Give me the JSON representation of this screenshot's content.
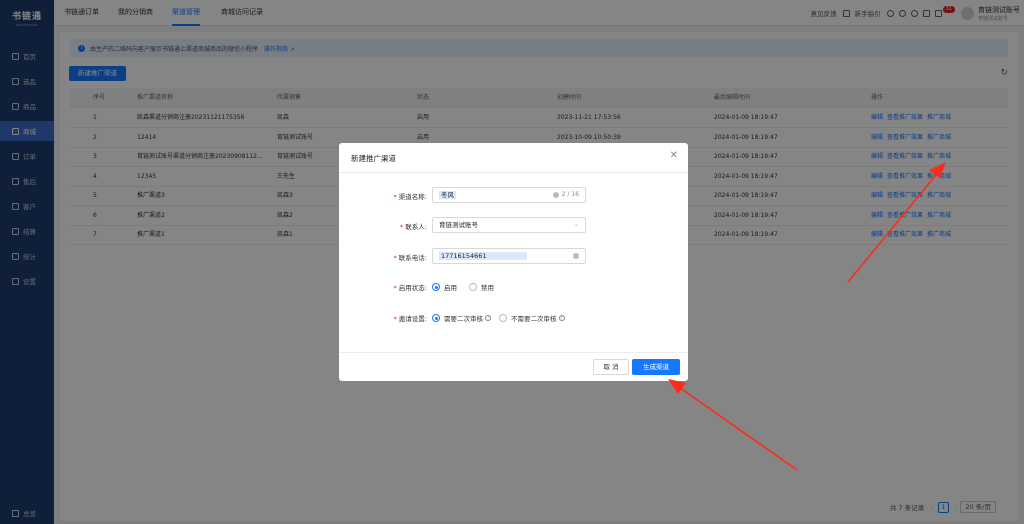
{
  "app": {
    "logo_title": "书链通",
    "logo_sub": "SHULIANTONG"
  },
  "sidebar": {
    "items": [
      {
        "label": "首页"
      },
      {
        "label": "选品"
      },
      {
        "label": "商品"
      },
      {
        "label": "商城"
      },
      {
        "label": "订单"
      },
      {
        "label": "售后"
      },
      {
        "label": "客户"
      },
      {
        "label": "结算"
      },
      {
        "label": "统计"
      },
      {
        "label": "设置"
      }
    ],
    "bottom_label": "总览"
  },
  "topbar": {
    "tabs": [
      {
        "label": "书链通订单"
      },
      {
        "label": "我的分销商"
      },
      {
        "label": "渠道管理"
      },
      {
        "label": "商城访问记录"
      }
    ],
    "feedback": "意见反馈",
    "guide": "新手指引",
    "badge_count": "31",
    "account_name": "育链测试账号",
    "account_sub": "育链测试账号"
  },
  "notice": {
    "text": "由生产的二维码向客户展示书链通上渠道商城商品的微信小程序",
    "link": "操作指南 >"
  },
  "toolbar": {
    "new_channel": "新建推广渠道",
    "refresh_icon": "↻"
  },
  "table": {
    "headers": [
      "序号",
      "推广渠道名称",
      "所属销售",
      "状态",
      "创建时间",
      "最后编辑时间",
      "操作"
    ],
    "rows": [
      [
        "1",
        "凯森渠道分销商注册20231121175356",
        "凯森",
        "启用",
        "2023-11-21 17:53:56",
        "2024-01-09 18:19:47"
      ],
      [
        "2",
        "12414",
        "育链测试账号",
        "启用",
        "2023-10-09 10:50:39",
        "2024-01-09 18:19:47"
      ],
      [
        "3",
        "育链测试账号渠道分销商注册20230908112...",
        "育链测试账号",
        "",
        "",
        "2024-01-09 18:19:47"
      ],
      [
        "4",
        "12345",
        "王先生",
        "",
        "",
        "2024-01-09 18:19:47"
      ],
      [
        "5",
        "推广渠道3",
        "凯森3",
        "",
        "",
        "2024-01-09 18:19:47"
      ],
      [
        "6",
        "推广渠道2",
        "凯森2",
        "",
        "",
        "2024-01-09 18:19:47"
      ],
      [
        "7",
        "推广渠道1",
        "凯森1",
        "",
        "",
        "2024-01-09 18:19:47"
      ]
    ],
    "ops": [
      "编辑",
      "查看推广效果",
      "推广商城"
    ]
  },
  "pager": {
    "total": "共 7 条记录",
    "page": "1",
    "size": "20 条/页"
  },
  "modal": {
    "title": "新建推广渠道",
    "close_icon": "✕",
    "fields": {
      "name_label": "渠道名称:",
      "name_value": "冬风",
      "name_count": "2 / 16",
      "sales_label": "联系人:",
      "sales_value": "育链测试账号",
      "phone_label": "联系电话:",
      "phone_value": "17716154661",
      "status_label": "启用状态:",
      "status_on": "启用",
      "status_off": "禁用",
      "invite_label": "邀请设置:",
      "invite_a": "需要二次审核",
      "invite_b": "不需要二次审核"
    },
    "cancel": "取 消",
    "confirm": "生成渠道"
  },
  "colors": {
    "primary": "#1677ff",
    "sidebar": "#1d3a6e",
    "arrow": "#ff2a1a"
  }
}
